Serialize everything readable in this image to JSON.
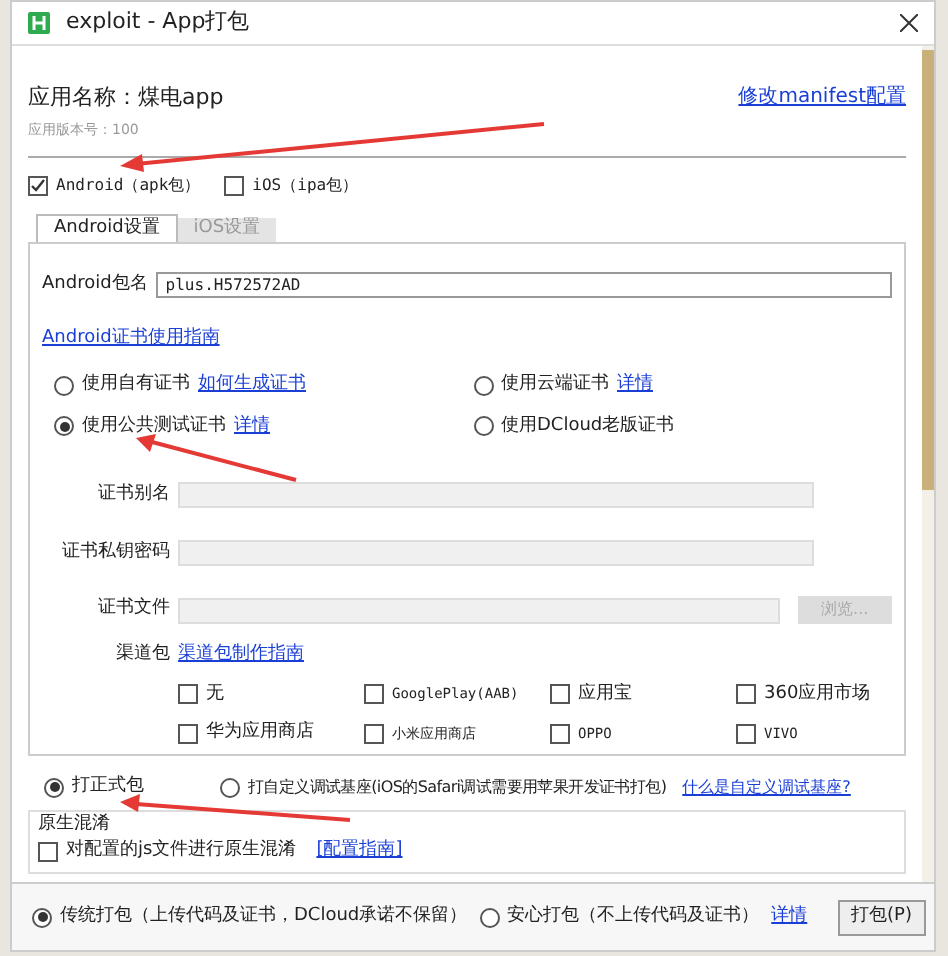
{
  "window": {
    "title": "exploit - App打包"
  },
  "app": {
    "name": "应用名称：煤电app",
    "version": "应用版本号：100",
    "manifest_link": "修改manifest配置"
  },
  "platforms": [
    {
      "label": "Android（apk包）",
      "checked": true
    },
    {
      "label": "iOS（ipa包）",
      "checked": false
    }
  ],
  "tabs": [
    {
      "label": "Android设置",
      "selected": true
    },
    {
      "label": "iOS设置",
      "selected": false
    }
  ],
  "package": {
    "label": "Android包名",
    "value": "plus.H572572AD"
  },
  "cert_guide_link": "Android证书使用指南",
  "cert_options": [
    {
      "label": "使用自有证书",
      "link": "如何生成证书",
      "selected": false
    },
    {
      "label": "使用云端证书",
      "link": "详情",
      "selected": false
    },
    {
      "label": "使用公共测试证书",
      "link": "详情",
      "selected": true
    },
    {
      "label": "使用DCloud老版证书",
      "selected": false
    }
  ],
  "cert_fields": [
    {
      "label": "证书别名"
    },
    {
      "label": "证书私钥密码"
    },
    {
      "label": "证书文件"
    }
  ],
  "browse_button": {
    "label": "浏览...",
    "disabled": true
  },
  "channels": {
    "label": "渠道包",
    "link": "渠道包制作指南",
    "items": [
      {
        "label": "无",
        "checked": false
      },
      {
        "label": "GooglePlay(AAB)",
        "checked": false
      },
      {
        "label": "应用宝",
        "checked": false
      },
      {
        "label": "360应用市场",
        "checked": false
      },
      {
        "label": "华为应用商店",
        "checked": false
      },
      {
        "label": "小米应用商店",
        "checked": false
      },
      {
        "label": "OPPO",
        "checked": false
      },
      {
        "label": "VIVO",
        "checked": false
      }
    ]
  },
  "build_types": [
    {
      "label": "打正式包",
      "selected": true
    },
    {
      "label": "打自定义调试基座(iOS的Safari调试需要用苹果开发证书打包)",
      "selected": false
    }
  ],
  "debug_link": "什么是自定义调试基座?",
  "obfuscation": {
    "title": "原生混淆",
    "label": "对配置的js文件进行原生混淆",
    "checked": false,
    "link": "[配置指南]"
  },
  "pack_modes": [
    {
      "label": "传统打包（上传代码及证书，DCloud承诺不保留）",
      "selected": true
    },
    {
      "label": "安心打包（不上传代码及证书）",
      "selected": false
    }
  ],
  "pack_link": "详情",
  "pack_button": "打包(P)"
}
